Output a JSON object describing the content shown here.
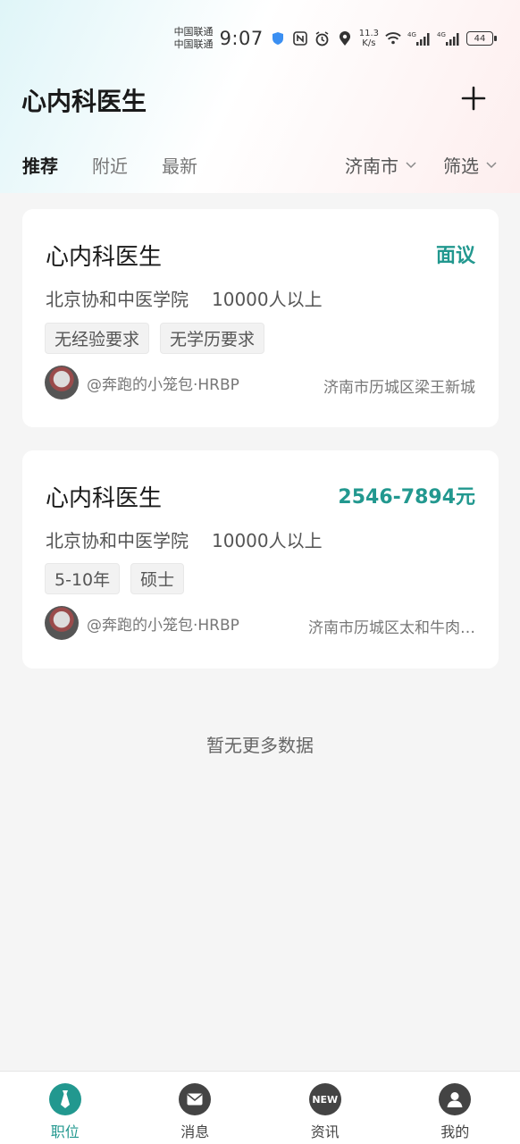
{
  "status_bar": {
    "carrier_1": "中国联通",
    "carrier_2": "中国联通",
    "time": "9:07",
    "speed_value": "11.3",
    "speed_unit": "K/s",
    "network_1": "4G",
    "network_2": "4G",
    "battery": "44"
  },
  "header": {
    "title": "心内科医生"
  },
  "tabs": [
    {
      "label": "推荐",
      "active": true
    },
    {
      "label": "附近",
      "active": false
    },
    {
      "label": "最新",
      "active": false
    }
  ],
  "filters": {
    "city": "济南市",
    "filter": "筛选"
  },
  "jobs": [
    {
      "title": "心内科医生",
      "salary": "面议",
      "company": "北京协和中医学院",
      "size": "10000人以上",
      "tags": [
        "无经验要求",
        "无学历要求"
      ],
      "recruiter": "@奔跑的小笼包·HRBP",
      "location": "济南市历城区梁王新城"
    },
    {
      "title": "心内科医生",
      "salary": "2546-7894元",
      "company": "北京协和中医学院",
      "size": "10000人以上",
      "tags": [
        "5-10年",
        "硕士"
      ],
      "recruiter": "@奔跑的小笼包·HRBP",
      "location": "济南市历城区太和牛肉…"
    }
  ],
  "no_more": "暂无更多数据",
  "bottom_nav": [
    {
      "label": "职位",
      "icon": "tie-icon",
      "active": true
    },
    {
      "label": "消息",
      "icon": "mail-icon",
      "active": false
    },
    {
      "label": "资讯",
      "icon": "new-icon",
      "icon_text": "NEW",
      "active": false
    },
    {
      "label": "我的",
      "icon": "user-icon",
      "active": false
    }
  ],
  "colors": {
    "accent": "#22988f"
  }
}
